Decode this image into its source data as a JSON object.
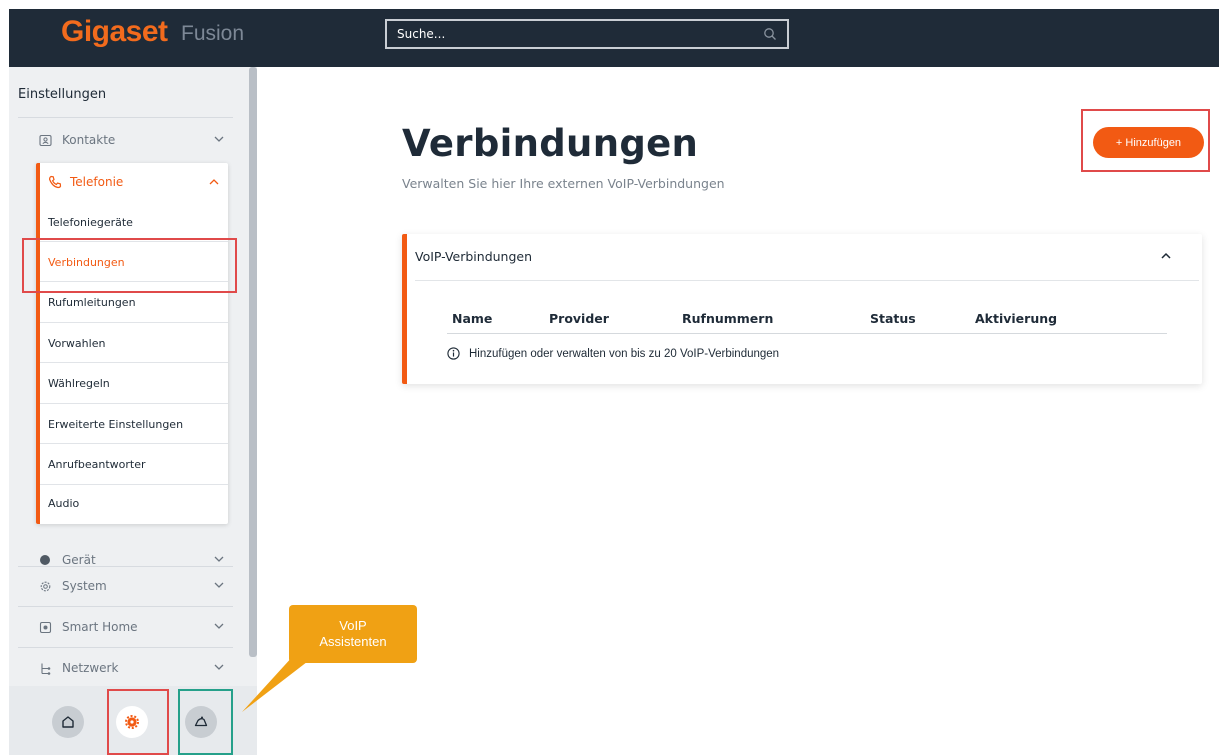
{
  "header": {
    "brand": "Gigaset",
    "product": "Fusion",
    "search_placeholder": "Suche..."
  },
  "sidebar": {
    "title": "Einstellungen",
    "items": [
      {
        "label": "Kontakte",
        "icon": "contacts-icon"
      },
      {
        "label": "Telefonie",
        "icon": "phone-icon",
        "expanded": true
      },
      {
        "label": "Gerät",
        "icon": "device-icon"
      },
      {
        "label": "System",
        "icon": "system-gear-icon"
      },
      {
        "label": "Smart Home",
        "icon": "smart-home-icon"
      },
      {
        "label": "Netzwerk",
        "icon": "network-icon"
      }
    ],
    "telefonie_subitems": [
      "Telefoniegeräte",
      "Verbindungen",
      "Rufumleitungen",
      "Vorwahlen",
      "Wählregeln",
      "Erweiterte Einstellungen",
      "Anrufbeantworter",
      "Audio"
    ],
    "active_subitem": "Verbindungen",
    "bottom_buttons": [
      "home-icon",
      "settings-gear-icon",
      "assistant-icon"
    ]
  },
  "callout": {
    "line1": "VoIP",
    "line2": "Assistenten"
  },
  "main": {
    "title": "Verbindungen",
    "subtitle": "Verwalten Sie hier Ihre externen VoIP-Verbindungen",
    "add_button": "+ Hinzufügen",
    "card": {
      "title": "VoIP-Verbindungen",
      "columns": [
        "Name",
        "Provider",
        "Rufnummern",
        "Status",
        "Aktivierung"
      ],
      "info": "Hinzufügen oder verwalten von bis zu 20 VoIP-Verbindungen"
    }
  },
  "colors": {
    "accent": "#f25a13",
    "header_bg": "#1f2b38",
    "callout": "#f0a114",
    "highlight_red": "#e04a4a",
    "highlight_teal": "#25a08a"
  }
}
